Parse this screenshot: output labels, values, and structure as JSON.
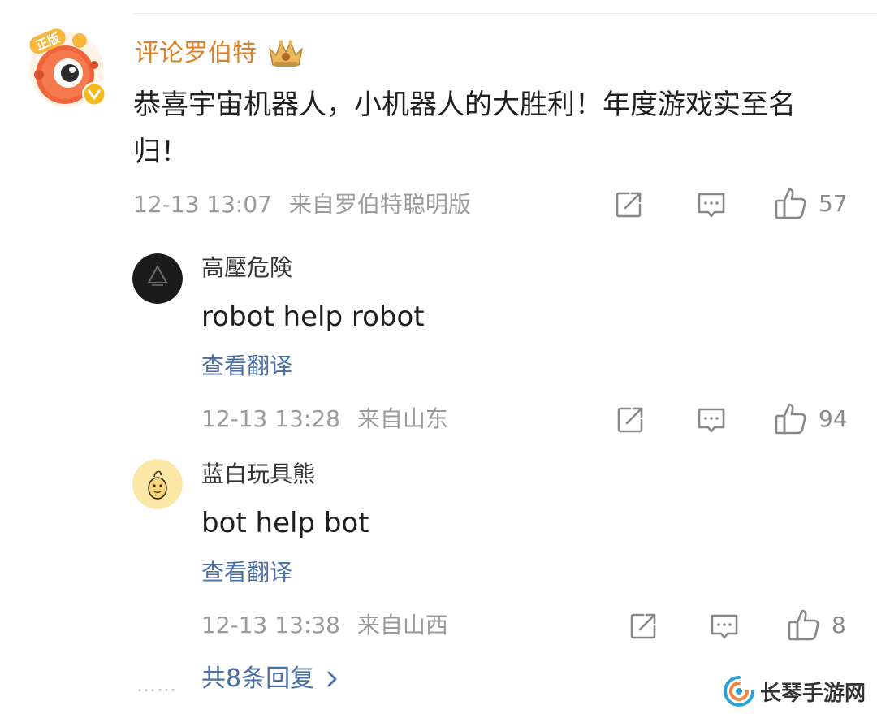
{
  "main_comment": {
    "username": "评论罗伯特",
    "avatar_badge": "正版",
    "text": "恭喜宇宙机器人，小机器人的大胜利！年度游戏实至名归！",
    "time": "12-13 13:07",
    "source": "来自罗伯特聪明版",
    "likes": "57"
  },
  "replies": [
    {
      "username": "高壓危険",
      "text": "robot help robot",
      "translate": "查看翻译",
      "time": "12-13 13:28",
      "source": "来自山东",
      "likes": "94"
    },
    {
      "username": "蓝白玩具熊",
      "text": "bot help bot",
      "translate": "查看翻译",
      "time": "12-13 13:38",
      "source": "来自山西",
      "likes": "8"
    }
  ],
  "more_replies": {
    "dots": "……",
    "label": "共8条回复"
  },
  "watermark": {
    "text": "长琴手游网"
  },
  "colors": {
    "username_main": "#d9822b",
    "link_blue": "#4a6fa5",
    "meta_gray": "#9a9a9a"
  }
}
